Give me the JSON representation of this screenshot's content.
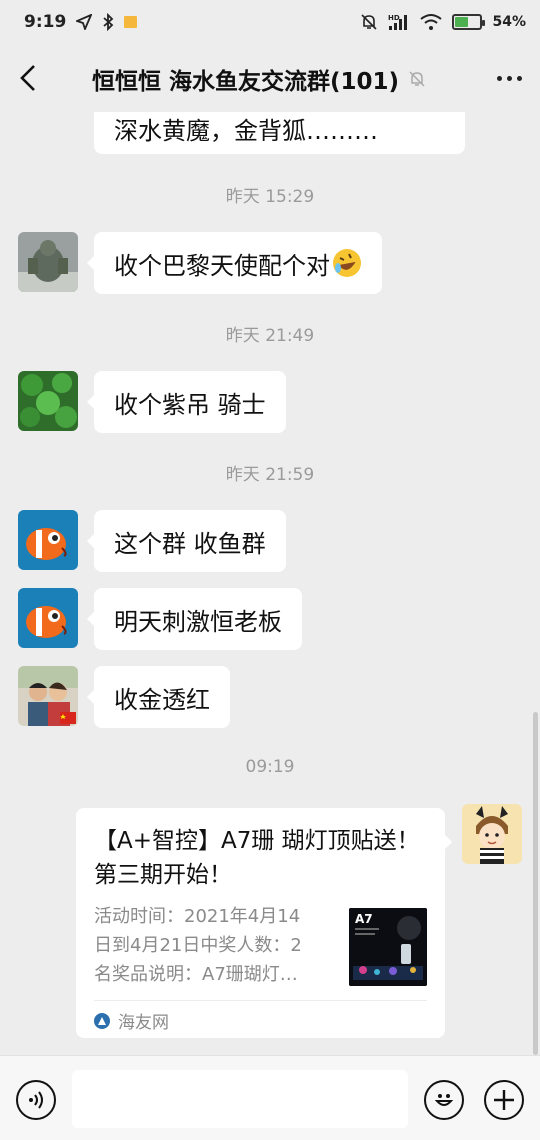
{
  "status_bar": {
    "time": "9:19",
    "net_label": "HD",
    "battery_text": "54%",
    "battery_level": 0.54,
    "icons": [
      "location-arrow-icon",
      "bluetooth-icon",
      "notification-flag-icon",
      "mute-bell-icon",
      "signal-icon",
      "wifi-icon",
      "battery-icon"
    ]
  },
  "nav": {
    "title": "恒恒恒  海水鱼友交流群(101)",
    "back_icon": "chevron-left-icon",
    "muted_icon": "bell-off-icon",
    "more_icon": "more-dots-icon"
  },
  "chat": {
    "top_partial_message": "深水黄魔，金背狐………",
    "timestamps": [
      "昨天 15:29",
      "昨天 21:49",
      "昨天 21:59",
      "09:19"
    ],
    "messages": [
      {
        "text": "收个巴黎天使配个对",
        "emoji": "rolling-laugh-emoji",
        "avatar": "warrior-statue-avatar"
      },
      {
        "text": "收个紫吊 骑士",
        "avatar": "clover-leaves-avatar"
      },
      {
        "text": "这个群 收鱼群",
        "avatar": "clownfish-avatar"
      },
      {
        "text": "明天刺激恒老板",
        "avatar": "clownfish-avatar"
      },
      {
        "text": "收金透红",
        "avatar": "couple-photo-avatar"
      }
    ],
    "link_card": {
      "title": "【A+智控】A7珊 瑚灯顶贴送！第三期开始！",
      "description": "活动时间：2021年4月14日到4月21日中奖人数：2名奖品说明：A7珊瑚灯…",
      "desc_lines": [
        "活动时间：2021年4月14",
        "日到4月21日中奖人数：2",
        "名奖品说明：A7珊瑚灯…"
      ],
      "thumb_label": "A7",
      "source": "海友网"
    }
  },
  "input_bar": {
    "value": "",
    "voice_icon": "voice-icon",
    "emoji_icon": "emoji-icon",
    "plus_icon": "plus-icon"
  }
}
